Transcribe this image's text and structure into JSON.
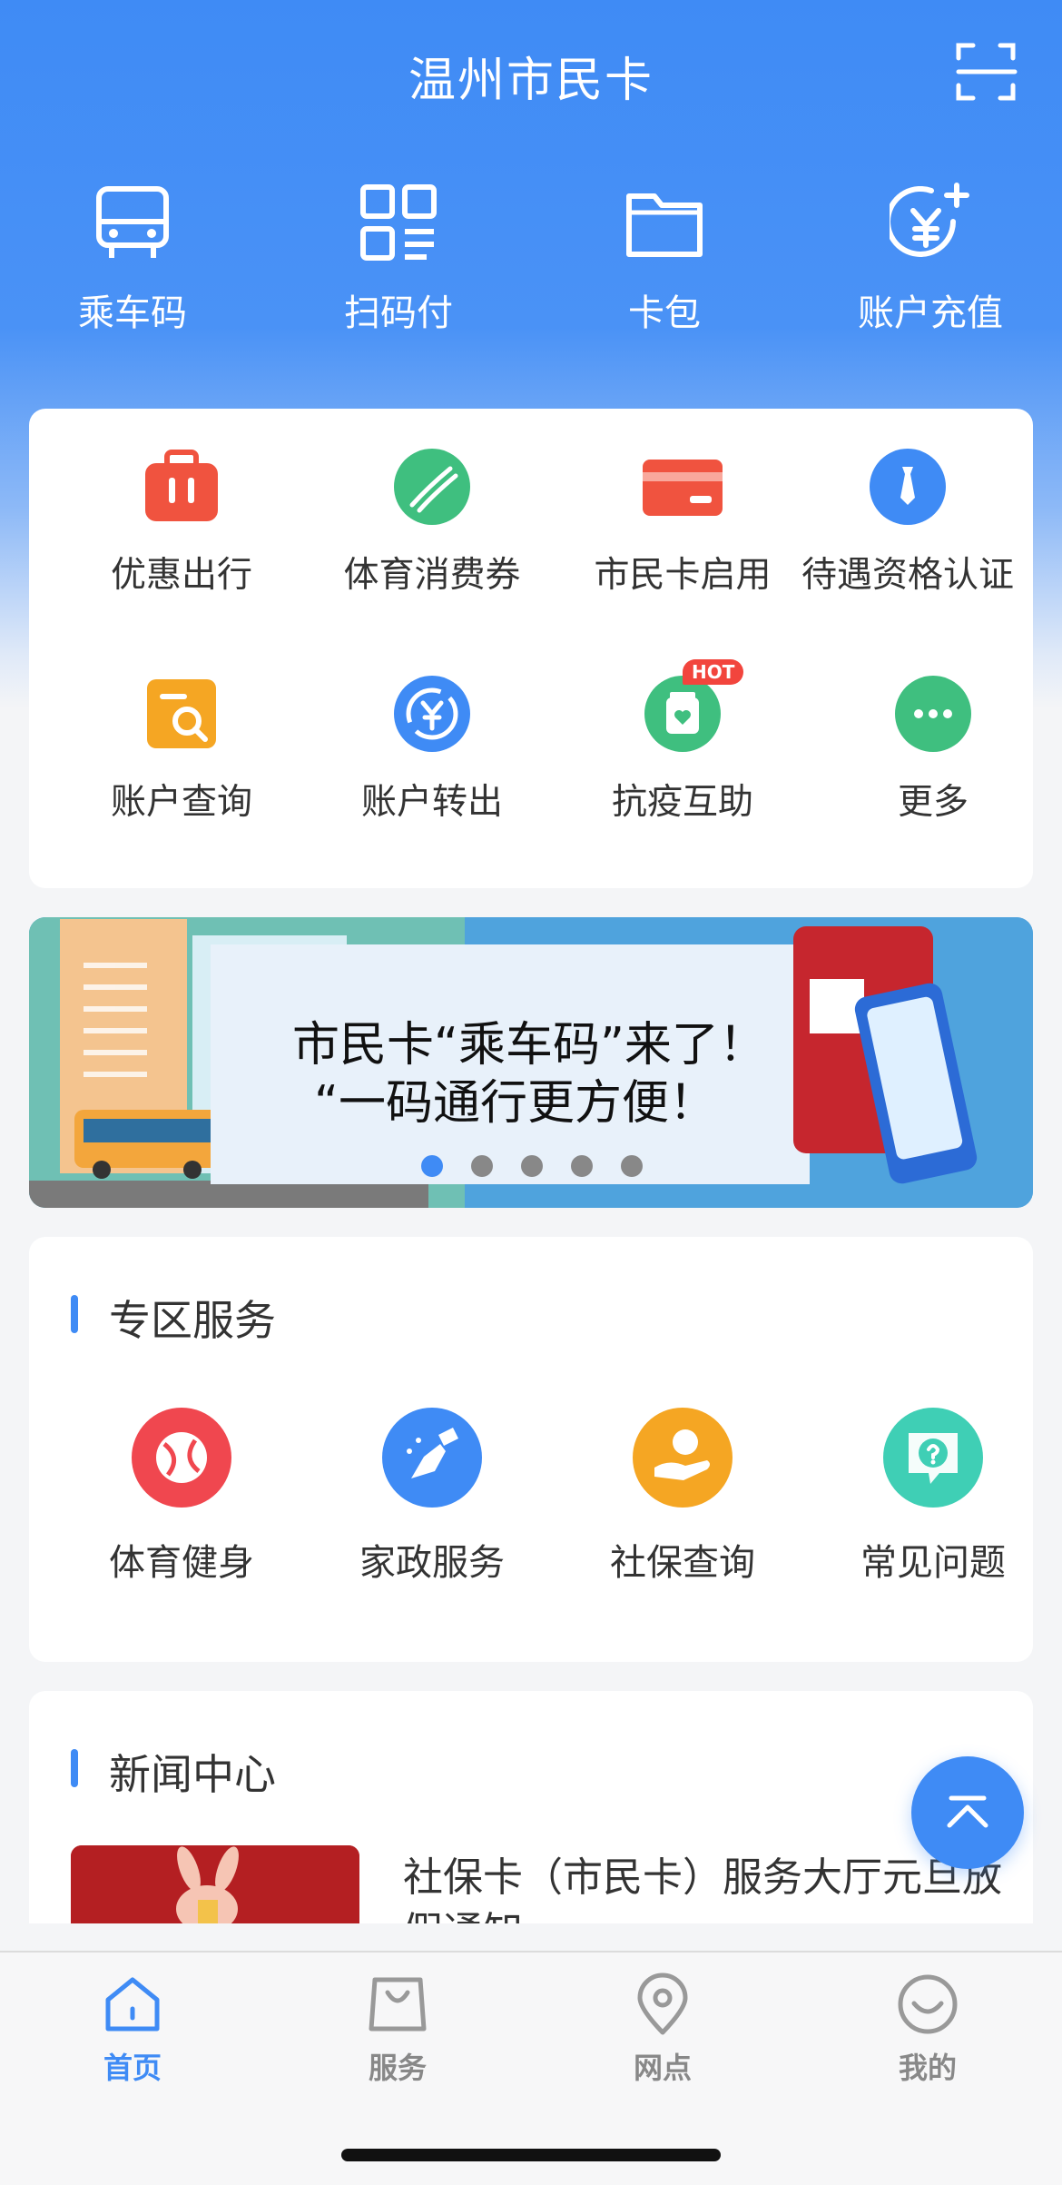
{
  "header": {
    "title": "温州市民卡"
  },
  "quick_actions": [
    {
      "label": "乘车码",
      "icon": "bus-icon"
    },
    {
      "label": "扫码付",
      "icon": "qr-pay-icon"
    },
    {
      "label": "卡包",
      "icon": "folder-icon"
    },
    {
      "label": "账户充值",
      "icon": "yen-plus-icon"
    }
  ],
  "services": [
    {
      "label": "优惠出行",
      "icon": "luggage-icon",
      "color": "#f0533f"
    },
    {
      "label": "体育消费券",
      "icon": "sports-ball-icon",
      "color": "#3fbf7f"
    },
    {
      "label": "市民卡启用",
      "icon": "card-icon",
      "color": "#f0533f"
    },
    {
      "label": "待遇资格认证",
      "icon": "tie-icon",
      "color": "#3f8bf5"
    },
    {
      "label": "账户查询",
      "icon": "doc-search-icon",
      "color": "#f5a623"
    },
    {
      "label": "账户转出",
      "icon": "yen-transfer-icon",
      "color": "#3f8bf5"
    },
    {
      "label": "抗疫互助",
      "icon": "medicine-icon",
      "color": "#3fbf7f",
      "badge": "HOT"
    },
    {
      "label": "更多",
      "icon": "more-icon",
      "color": "#3fbf7f"
    }
  ],
  "banner": {
    "line1": "市民卡“乘车码”来了！",
    "line2": "“一码通行更方便！",
    "page_count": 5,
    "active_page": 1
  },
  "zone": {
    "title": "专区服务",
    "items": [
      {
        "label": "体育健身",
        "icon": "fitness-icon",
        "color": "#f0474f"
      },
      {
        "label": "家政服务",
        "icon": "broom-icon",
        "color": "#3f8bf5"
      },
      {
        "label": "社保查询",
        "icon": "social-security-icon",
        "color": "#f5a623"
      },
      {
        "label": "常见问题",
        "icon": "question-icon",
        "color": "#3fcfb5"
      }
    ]
  },
  "news": {
    "title": "新闻中心",
    "items": [
      {
        "title": "社保卡（市民卡）服务大厅元旦放假通知"
      }
    ]
  },
  "tabbar": [
    {
      "label": "首页",
      "icon": "home-icon",
      "active": true
    },
    {
      "label": "服务",
      "icon": "bag-icon",
      "active": false
    },
    {
      "label": "网点",
      "icon": "location-icon",
      "active": false
    },
    {
      "label": "我的",
      "icon": "smile-icon",
      "active": false
    }
  ],
  "colors": {
    "primary": "#3f8bf5",
    "hot": "#f2453d"
  }
}
